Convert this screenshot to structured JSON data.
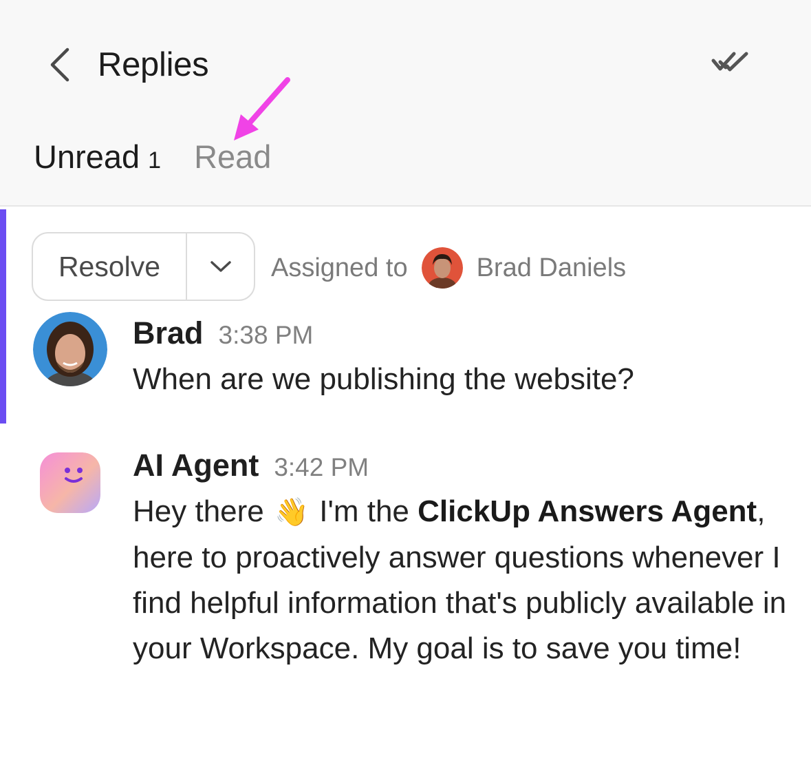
{
  "header": {
    "title": "Replies",
    "back_icon": "chevron-left-icon",
    "mark_all_read_icon": "double-check-icon"
  },
  "tabs": {
    "unread_label": "Unread",
    "unread_count": "1",
    "read_label": "Read"
  },
  "annotation": {
    "arrow_color": "#f043e6"
  },
  "thread": {
    "accent_color": "#6b4df2",
    "resolve_label": "Resolve",
    "assigned_label": "Assigned to",
    "assignee_name": "Brad Daniels"
  },
  "messages": [
    {
      "author": "Brad",
      "time": "3:38 PM",
      "text": "When are we publishing the website?"
    },
    {
      "author": "AI Agent",
      "time": "3:42 PM",
      "text_parts": {
        "greeting": "Hey there",
        "emoji": "👋",
        "intro": "I'm the",
        "bold_name": "ClickUp Answers Agent",
        "rest": ", here to proactively answer questions whenever I find helpful information that's publicly available in your Workspace. My goal is to save you time!"
      }
    }
  ]
}
